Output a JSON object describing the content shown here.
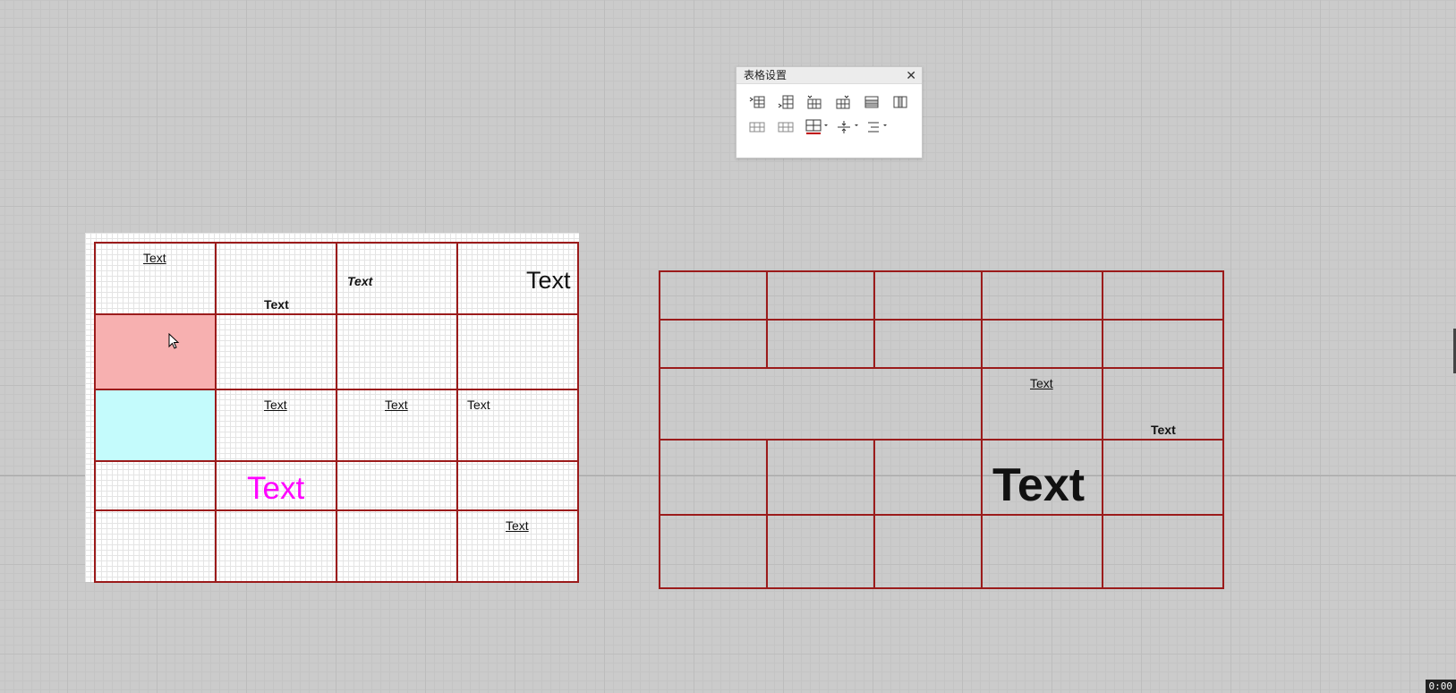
{
  "panel": {
    "title": "表格设置",
    "close_label": "✕",
    "row1_icons": [
      "insert-column-left-icon",
      "insert-row-below-icon",
      "insert-row-above-icon",
      "insert-column-right-icon",
      "delete-row-icon",
      "delete-column-icon"
    ],
    "row2_icons": [
      "merge-cells-icon",
      "split-cells-icon",
      "border-style-icon",
      "vertical-align-icon",
      "horizontal-align-icon"
    ]
  },
  "left_table": {
    "r1c1": "Text",
    "r1c2": "Text",
    "r1c3": "Text",
    "r1c4": "Text",
    "r3c2": "Text",
    "r3c3": "Text",
    "r3c4": "Text",
    "r4c2": "Text",
    "r5c4": "Text",
    "colors": {
      "selected_cell": "#f7b0b0",
      "highlight_cell": "#c4fbfc",
      "magenta_text": "#ff00ff",
      "border": "#9b1b1b"
    }
  },
  "right_table": {
    "r3c4": "Text",
    "r3c5": "Text",
    "r4c4": "Text"
  },
  "status": {
    "time": "0:00"
  }
}
